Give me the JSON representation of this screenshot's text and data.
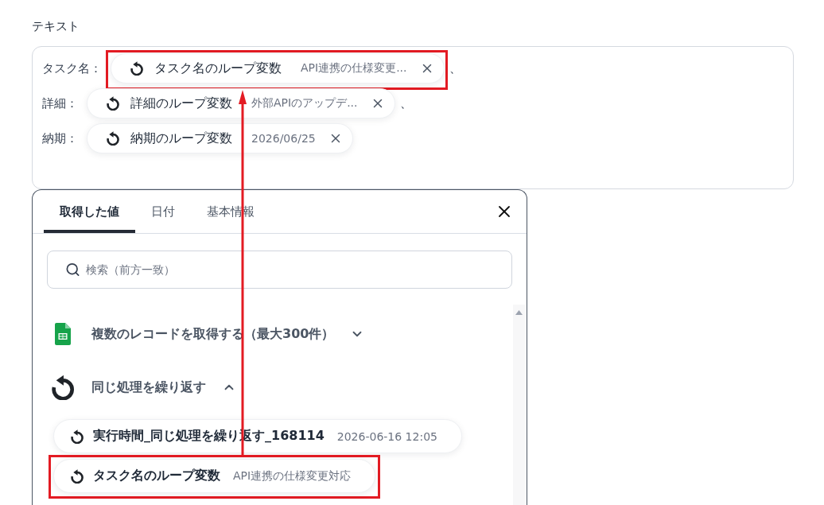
{
  "section_label": "テキスト",
  "text_field": {
    "lines": [
      {
        "label": "タスク名：",
        "chip": {
          "name": "タスク名のループ変数",
          "value": "API連携の仕様変更...",
          "highlighted": true
        },
        "suffix": "、"
      },
      {
        "label": "詳細：",
        "chip": {
          "name": "詳細のループ変数",
          "value": "外部APIのアップデ...",
          "highlighted": false
        },
        "suffix": "、"
      },
      {
        "label": "納期：",
        "chip": {
          "name": "納期のループ変数",
          "value": "2026/06/25",
          "highlighted": false
        }
      }
    ]
  },
  "picker": {
    "tabs": [
      {
        "label": "取得した値",
        "selected": true
      },
      {
        "label": "日付",
        "selected": false
      },
      {
        "label": "基本情報",
        "selected": false
      }
    ],
    "search": {
      "placeholder": "検索（前方一致）"
    },
    "groups": [
      {
        "kind": "sheets",
        "title": "複数のレコードを取得する（最大300件）",
        "expanded": false
      },
      {
        "kind": "loop",
        "title": "同じ処理を繰り返す",
        "expanded": true,
        "items": [
          {
            "name": "実行時間_同じ処理を繰り返す_168114",
            "value": "2026-06-16 12:05",
            "highlighted": false
          },
          {
            "name": "タスク名のループ変数",
            "value": "API連携の仕様変更対応",
            "highlighted": true
          }
        ]
      }
    ]
  },
  "annotations": {
    "arrow": true
  }
}
